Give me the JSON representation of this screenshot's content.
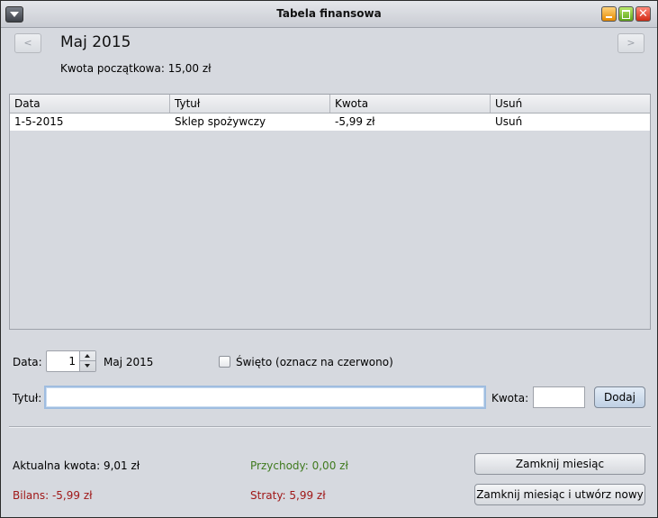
{
  "window": {
    "title": "Tabela finansowa"
  },
  "header": {
    "prev_label": "<",
    "next_label": ">",
    "month_title": "Maj 2015",
    "start_amount": "Kwota początkowa: 15,00 zł"
  },
  "table": {
    "columns": [
      "Data",
      "Tytuł",
      "Kwota",
      "Usuń"
    ],
    "rows": [
      {
        "date": "1-5-2015",
        "title": "Sklep spożywczy",
        "amount": "-5,99 zł",
        "delete": "Usuń"
      }
    ]
  },
  "form": {
    "date_label": "Data:",
    "day_value": "1",
    "month_label": "Maj 2015",
    "holiday_label": "Święto (oznacz na czerwono)",
    "holiday_checked": false,
    "title_label": "Tytuł:",
    "title_value": "",
    "amount_label": "Kwota:",
    "amount_value": "",
    "add_button": "Dodaj"
  },
  "summary": {
    "current_amount": "Aktualna kwota: 9,01 zł",
    "balance": "Bilans: -5,99 zł",
    "income": "Przychody: 0,00 zł",
    "losses": "Straty: 5,99 zł",
    "close_month_button": "Zamknij miesiąc",
    "close_and_new_button": "Zamknij miesiąc i utwórz nowy"
  },
  "colors": {
    "income": "#3f7a1e",
    "negative": "#a01818",
    "window_bg": "#d6d9df"
  },
  "icons": {
    "system_menu": "chevron-down-icon",
    "minimize": "minimize-icon",
    "maximize": "maximize-icon",
    "close": "close-icon"
  }
}
